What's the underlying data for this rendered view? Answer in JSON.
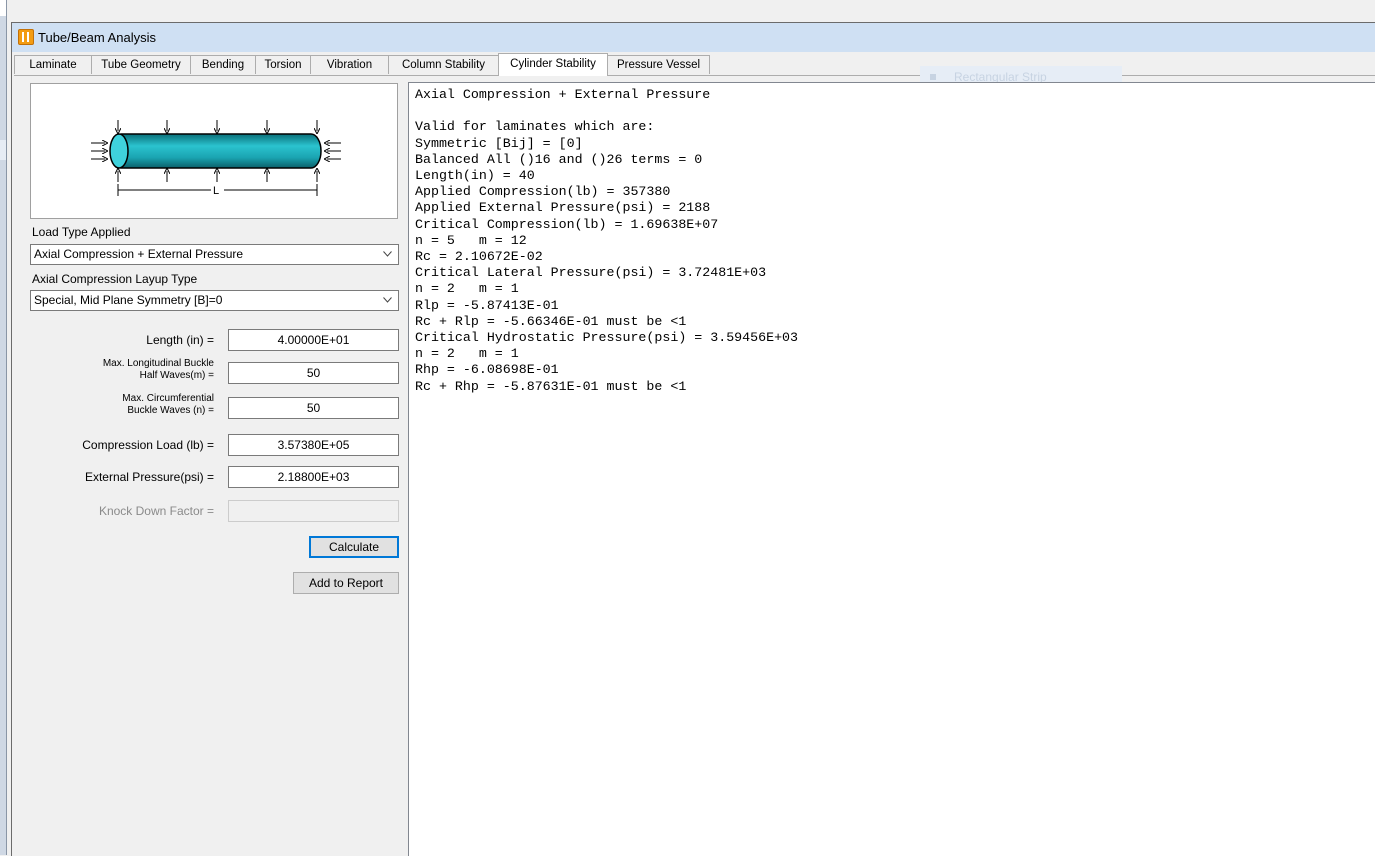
{
  "window": {
    "title": "Tube/Beam Analysis"
  },
  "tabs": [
    {
      "label": "Laminate"
    },
    {
      "label": "Tube Geometry"
    },
    {
      "label": "Bending"
    },
    {
      "label": "Torsion"
    },
    {
      "label": "Vibration"
    },
    {
      "label": "Column Stability"
    },
    {
      "label": "Cylinder Stability"
    },
    {
      "label": "Pressure Vessel"
    }
  ],
  "active_tab": "Cylinder Stability",
  "ghost_item": {
    "label": "Rectangular Strip"
  },
  "diagram": {
    "length_label": "L",
    "tube_color": "#1aa3b0"
  },
  "form": {
    "load_type_label": "Load Type Applied",
    "load_type_value": "Axial Compression + External Pressure",
    "layup_label": "Axial Compression Layup Type",
    "layup_value": "Special, Mid Plane Symmetry [B]=0",
    "length": {
      "label": "Length (in) =",
      "value": "4.00000E+01"
    },
    "max_long": {
      "label_line1": "Max. Longitudinal Buckle",
      "label_line2": "Half Waves(m) =",
      "value": "50"
    },
    "max_circ": {
      "label_line1": "Max. Circumferential",
      "label_line2": "Buckle Waves (n) =",
      "value": "50"
    },
    "compression": {
      "label": "Compression Load (lb) =",
      "value": "3.57380E+05"
    },
    "pressure": {
      "label": "External Pressure(psi) =",
      "value": "2.18800E+03"
    },
    "knockdown": {
      "label": "Knock Down Factor =",
      "value": ""
    },
    "calculate_label": "Calculate",
    "add_report_label": "Add to Report"
  },
  "results": {
    "lines": [
      "Axial Compression + External Pressure",
      "",
      "Valid for laminates which are:",
      "Symmetric [Bij] = [0]",
      "Balanced All ()16 and ()26 terms = 0",
      "Length(in) = 40",
      "Applied Compression(lb) = 357380",
      "Applied External Pressure(psi) = 2188",
      "Critical Compression(lb) = 1.69638E+07",
      "n = 5   m = 12",
      "Rc = 2.10672E-02",
      "Critical Lateral Pressure(psi) = 3.72481E+03",
      "n = 2   m = 1",
      "Rlp = -5.87413E-01",
      "Rc + Rlp = -5.66346E-01 must be <1",
      "Critical Hydrostatic Pressure(psi) = 3.59456E+03",
      "n = 2   m = 1",
      "Rhp = -6.08698E-01",
      "Rc + Rhp = -5.87631E-01 must be <1"
    ]
  }
}
